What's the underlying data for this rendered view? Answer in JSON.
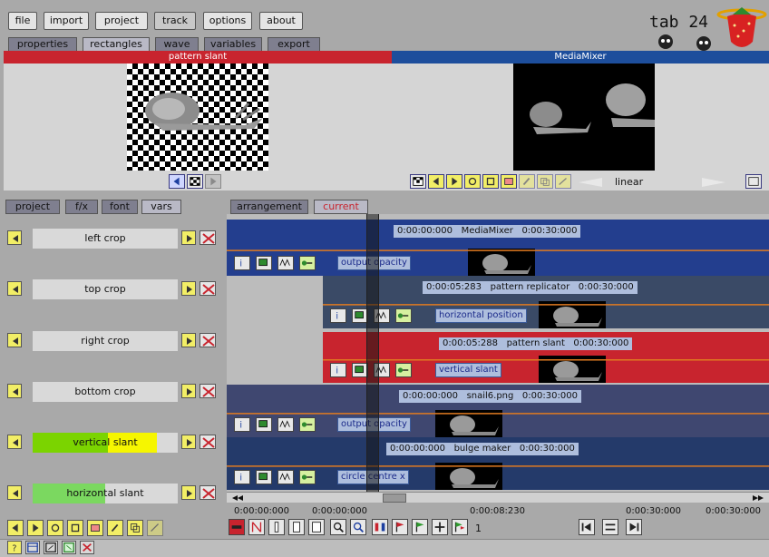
{
  "menu": [
    "file",
    "import",
    "project",
    "track",
    "options",
    "about"
  ],
  "menu_active": "track",
  "logo_text": "tab 24",
  "subtabs": [
    "properties",
    "rectangles",
    "wave",
    "variables",
    "export"
  ],
  "left_preview": {
    "title": "pattern slant"
  },
  "right_preview": {
    "title": "MediaMixer",
    "interp": "linear"
  },
  "left_panel_tabs": [
    "project",
    "f/x",
    "font",
    "vars"
  ],
  "right_panel_tabs": [
    "arrangement",
    "current"
  ],
  "params": [
    {
      "label": "left crop",
      "fill": 0,
      "color": ""
    },
    {
      "label": "top crop",
      "fill": 0,
      "color": ""
    },
    {
      "label": "right crop",
      "fill": 0,
      "color": ""
    },
    {
      "label": "bottom crop",
      "fill": 0,
      "color": ""
    },
    {
      "label": "vertical slant",
      "fill": 0.52,
      "color": "#7bd400",
      "highlight": "#f6f600"
    },
    {
      "label": "horizontal slant",
      "fill": 0.5,
      "color": "#7bd860"
    }
  ],
  "tracks": [
    {
      "start": "0:00:00:000",
      "name": "MediaMixer",
      "end": "0:00:30:000",
      "param": "output opacity",
      "color": "#233e8e"
    },
    {
      "start": "0:00:05:283",
      "name": "pattern replicator",
      "end": "0:00:30:000",
      "param": "horizontal position",
      "color": "#3a4a66"
    },
    {
      "start": "0:00:05:288",
      "name": "pattern slant",
      "end": "0:00:30:000",
      "param": "vertical slant",
      "color": "#c8242e"
    },
    {
      "start": "0:00:00:000",
      "name": "snail6.png",
      "end": "0:00:30:000",
      "param": "output opacity",
      "color": "#3f4770"
    },
    {
      "start": "0:00:00:000",
      "name": "bulge maker",
      "end": "0:00:30:000",
      "param": "circle centre x",
      "color": "#243a6a"
    }
  ],
  "timeline": {
    "times": [
      "0:00:00:000",
      "0:00:00:000",
      "0:00:08:230",
      "0:00:30:000",
      "0:00:30:000"
    ],
    "frame": "1"
  },
  "colors": {
    "accent_red": "#c8242e",
    "accent_blue": "#1d4e9c",
    "bg": "#a9a9a9"
  }
}
